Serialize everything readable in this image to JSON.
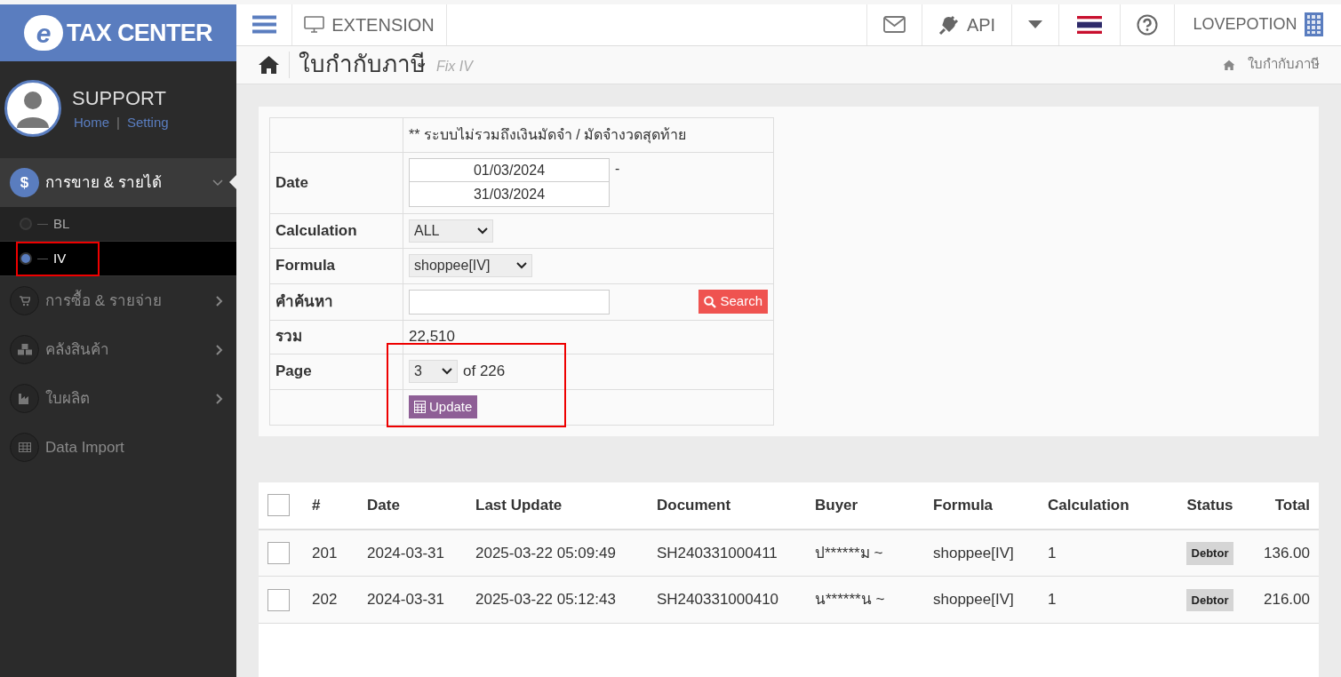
{
  "logo": {
    "text": "TAX CENTER",
    "letter": "e"
  },
  "user": {
    "name": "SUPPORT",
    "links": [
      "Home",
      "Setting"
    ],
    "separator": "|"
  },
  "sidebar": {
    "items": [
      {
        "label": "การขาย & รายได้",
        "kind": "dollar",
        "symbol": "$",
        "expanded": true,
        "children": [
          {
            "label": "BL",
            "selected": false,
            "annotated": false
          },
          {
            "label": "IV",
            "selected": true,
            "annotated": true
          }
        ]
      },
      {
        "label": "การซื้อ & รายจ่าย",
        "kind": "cart",
        "expanded": false
      },
      {
        "label": "คลังสินค้า",
        "kind": "boxes",
        "expanded": false
      },
      {
        "label": "ใบผลิต",
        "kind": "factory",
        "expanded": false
      },
      {
        "label": "Data Import",
        "kind": "table"
      }
    ]
  },
  "topbar": {
    "extension": "EXTENSION",
    "api": "API",
    "company": "LOVEPOTION"
  },
  "page_header": {
    "title": "ใบกำกับภาษี",
    "subtitle": "Fix IV",
    "breadcrumb": "ใบกำกับภาษี"
  },
  "filter": {
    "note": "** ระบบไม่รวมถึงเงินมัดจำ / มัดจำงวดสุดท้าย",
    "date_label": "Date",
    "date_from": "01/03/2024",
    "date_sep": "-",
    "date_to": "31/03/2024",
    "calculation_label": "Calculation",
    "calculation": "ALL",
    "formula_label": "Formula",
    "formula": "shoppee[IV]",
    "search_label": "คำค้นหา",
    "search_button": "Search",
    "total_label": "รวม",
    "total": "22,510",
    "page_label": "Page",
    "page": "3",
    "page_of": "of 226",
    "update_button": "Update",
    "annotated": true
  },
  "table": {
    "columns": [
      "#",
      "Date",
      "Last Update",
      "Document",
      "Buyer",
      "Formula",
      "Calculation",
      "Status",
      "Total"
    ],
    "header_checked": false,
    "rows": [
      {
        "checked": false,
        "cells": [
          "201",
          "2024-03-31",
          "2025-03-22 05:09:49",
          "SH240331000411",
          "ป******ม ~",
          "shoppee[IV]",
          "1"
        ],
        "status": "Debtor",
        "total": "136.00"
      },
      {
        "checked": false,
        "cells": [
          "202",
          "2024-03-31",
          "2025-03-22 05:12:43",
          "SH240331000410",
          "น******น ~",
          "shoppee[IV]",
          "1"
        ],
        "status": "Debtor",
        "total": "216.00"
      }
    ]
  }
}
